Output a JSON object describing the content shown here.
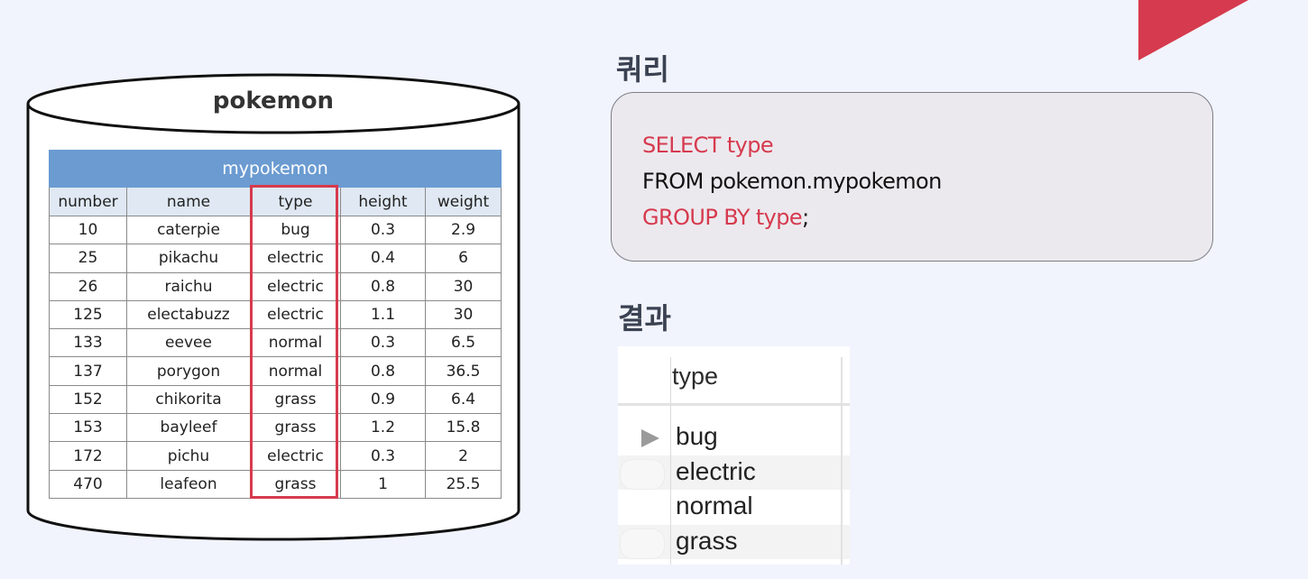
{
  "database": {
    "name": "pokemon",
    "table": {
      "name": "mypokemon",
      "columns": [
        "number",
        "name",
        "type",
        "height",
        "weight"
      ],
      "rows": [
        [
          "10",
          "caterpie",
          "bug",
          "0.3",
          "2.9"
        ],
        [
          "25",
          "pikachu",
          "electric",
          "0.4",
          "6"
        ],
        [
          "26",
          "raichu",
          "electric",
          "0.8",
          "30"
        ],
        [
          "125",
          "electabuzz",
          "electric",
          "1.1",
          "30"
        ],
        [
          "133",
          "eevee",
          "normal",
          "0.3",
          "6.5"
        ],
        [
          "137",
          "porygon",
          "normal",
          "0.8",
          "36.5"
        ],
        [
          "152",
          "chikorita",
          "grass",
          "0.9",
          "6.4"
        ],
        [
          "153",
          "bayleef",
          "grass",
          "1.2",
          "15.8"
        ],
        [
          "172",
          "pichu",
          "electric",
          "0.3",
          "2"
        ],
        [
          "470",
          "leafeon",
          "grass",
          "1",
          "25.5"
        ]
      ]
    }
  },
  "query": {
    "title": "쿼리",
    "lines": [
      [
        {
          "text": "SELECT type",
          "kw": true
        }
      ],
      [
        {
          "text": "FROM pokemon.mypokemon",
          "kw": false
        }
      ],
      [
        {
          "text": "GROUP BY type",
          "kw": true
        },
        {
          "text": ";",
          "kw": false
        }
      ]
    ]
  },
  "result": {
    "title": "결과",
    "column": "type",
    "rows": [
      "bug",
      "electric",
      "normal",
      "grass"
    ]
  },
  "colors": {
    "keyword": "#d63a4e",
    "table_header": "#6b9bd1",
    "highlight": "#d63a4e",
    "corner_accent": "#d63a4e"
  }
}
